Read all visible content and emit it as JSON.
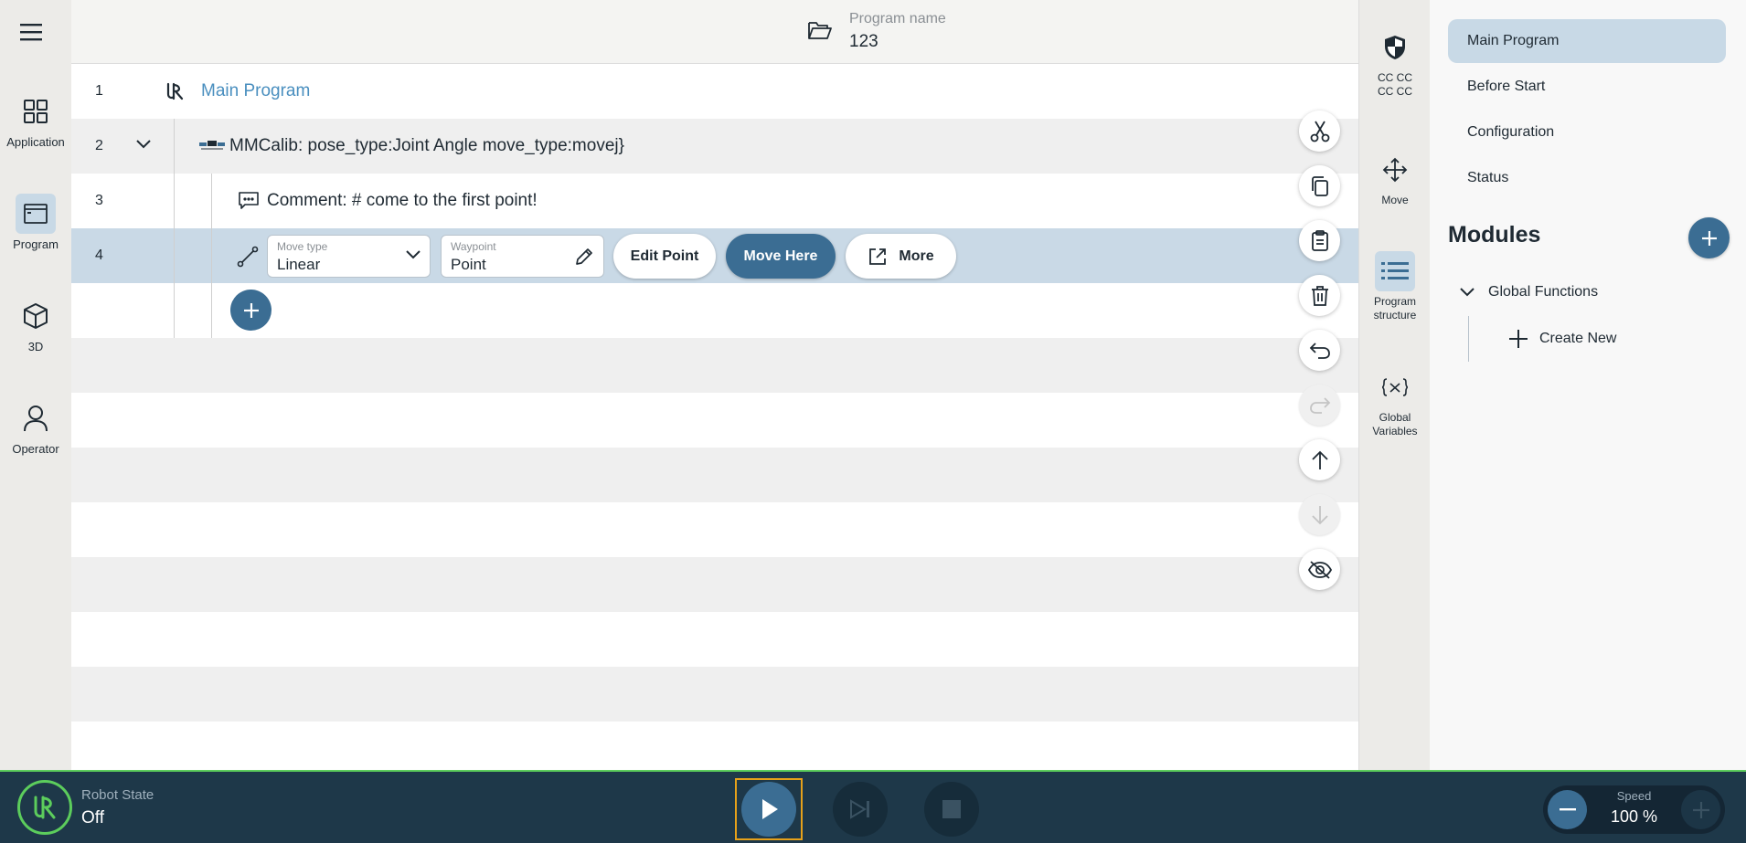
{
  "left_nav": {
    "items": [
      {
        "label": "Application"
      },
      {
        "label": "Program"
      },
      {
        "label": "3D"
      },
      {
        "label": "Operator"
      }
    ]
  },
  "header": {
    "program_name_label": "Program name",
    "program_name": "123"
  },
  "tree": {
    "rows": [
      {
        "num": "1",
        "text": "Main Program"
      },
      {
        "num": "2",
        "text": "MMCalib: pose_type:Joint Angle move_type:movej}"
      },
      {
        "num": "3",
        "text": "Comment: # come to the first point!"
      },
      {
        "num": "4"
      }
    ],
    "move_type": {
      "label": "Move type",
      "value": "Linear"
    },
    "waypoint": {
      "label": "Waypoint",
      "value": "Point"
    },
    "edit_point": "Edit Point",
    "move_here": "Move Here",
    "more": "More"
  },
  "rail": {
    "items": [
      {
        "label_line1": "CC CC",
        "label_line2": "CC CC"
      },
      {
        "label_line1": "Move"
      },
      {
        "label_line1": "Program",
        "label_line2": "structure"
      },
      {
        "label_line1": "Global",
        "label_line2": "Variables"
      }
    ]
  },
  "panel": {
    "nav": [
      {
        "label": "Main Program"
      },
      {
        "label": "Before Start"
      },
      {
        "label": "Configuration"
      },
      {
        "label": "Status"
      }
    ],
    "modules_title": "Modules",
    "global_functions": "Global Functions",
    "create_new": "Create New"
  },
  "bottom": {
    "robot_state_label": "Robot State",
    "robot_state": "Off",
    "speed_label": "Speed",
    "speed_value": "100 %"
  },
  "colors": {
    "accent": "#3b6d93",
    "selected_row": "#c9d9e6",
    "bottom_bar": "#1e3849",
    "status_green": "#5ccd5c",
    "focus_outline": "#e6a11a"
  }
}
